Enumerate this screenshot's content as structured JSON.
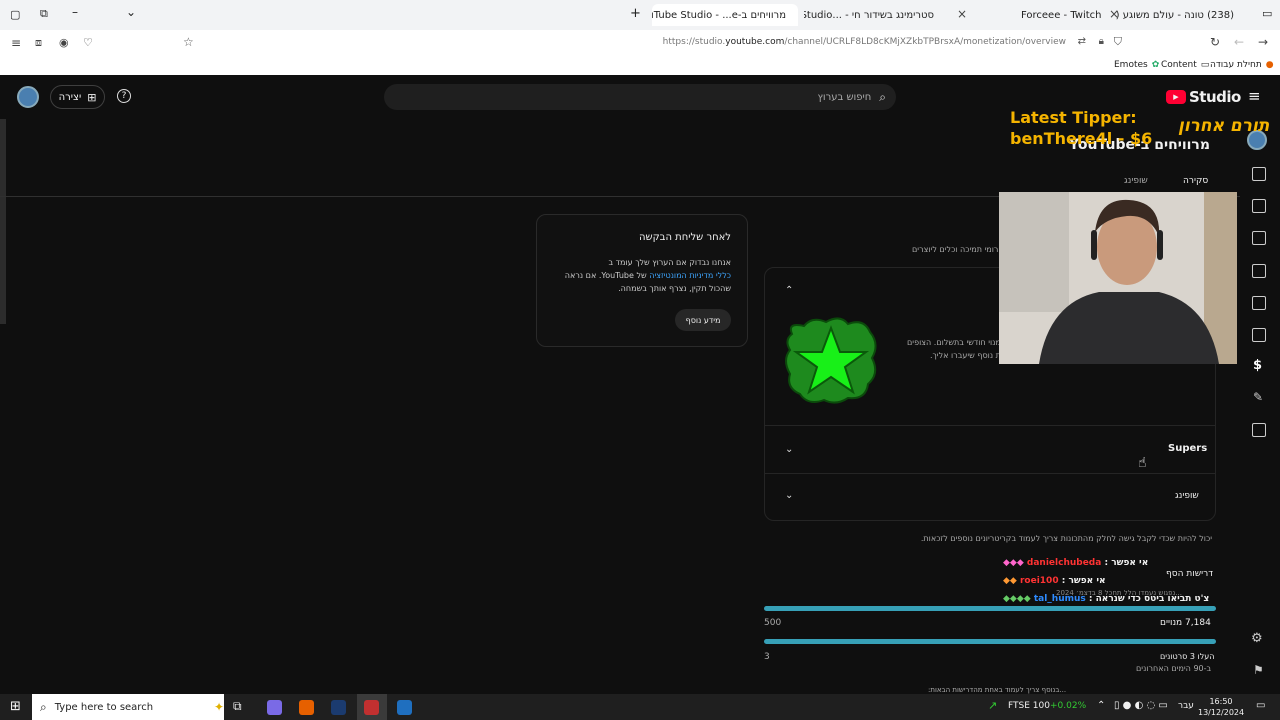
{
  "browser": {
    "tabs": [
      {
        "title": "מרוויחים ב-YouTube Studio - ...e",
        "type": "yt",
        "active": true
      },
      {
        "title": "סטרימינג בשידור חי - ...be Studio",
        "type": "yt",
        "active": false
      },
      {
        "title": "Forceee - Twitch",
        "type": "tw",
        "active": false
      },
      {
        "title": "(238) טונה - עולם משוגע (עם רב",
        "type": "yt",
        "active": false
      }
    ],
    "url_prefix": "https://studio.",
    "url_domain": "youtube.com",
    "url_rest": "/channel/UCRLF8LD8cKMjXZkbTPBrsxA/monetization/overview",
    "bookmarks": [
      {
        "label": "Emotes"
      },
      {
        "label": "Content"
      },
      {
        "label": "תחילת עבודה"
      }
    ]
  },
  "studio": {
    "logo_text": "Studio",
    "search_placeholder": "חיפוש בערוץ",
    "create_label": "יצירה",
    "page_title": "מרוויחים ב-YouTube",
    "tabs": [
      {
        "label": "סקירה",
        "active": true
      },
      {
        "label": "שופינג",
        "active": false
      }
    ],
    "intro_fragment": "...רומי תמיכה וכלים ליוצרים",
    "card": {
      "title": "לאחר שליחת הבקשה",
      "text_1": "אנחנו נבדוק אם הערוץ שלך עומד ב",
      "link": "כללי מדיניות המונטיזציה",
      "text_2": "של YouTube. אם נראה שהכול תקין, נצרף אותך בשמחה.",
      "button": "מידע נוסף"
    },
    "panel": {
      "memberships_text_1": "...מנוי חודשי בתשלום. הצופים",
      "memberships_text_2": "...ת נוסף שיעברו אליך.",
      "supers_label": "Supers",
      "shopping_label": "שופינג"
    },
    "eligibility_note": "יכול להיות שכדי לקבל גישה לחלק מהתכונות צריך לעמוד בקריטריונים נוספים לזכאות.",
    "requirements_label": "דרישות הסף",
    "requirements_sub": "...נפגוש נעמדו הלל תחכל 8 בדצמ׳ 2024",
    "subscribers_label": "7,184 מנויים",
    "subscribers_target": "500",
    "uploads_label": "העלו 3 סרטונים",
    "uploads_sub": "ב-90 הימים האחרונים",
    "uploads_target": "3",
    "bottom_fragment": "...בנוסף צריך לעמוד באחת מהדרישות הבאות:"
  },
  "overlay": {
    "tipper_label": "Latest Tipper:",
    "tipper_value": "benThere4l - $6",
    "tipper_hebrew": "תורם אחרון",
    "chat": [
      {
        "prefix": "אי אפשר :",
        "user": "danielchubeda",
        "user_color": "#ff3333"
      },
      {
        "prefix": "אי אפשר :",
        "user": "roei100",
        "user_color": "#ff3333"
      },
      {
        "prefix": "צ'ט תביאו ביטס כדי שנראה :",
        "user": "tal_humus",
        "user_color": "#2e8bff"
      }
    ]
  },
  "taskbar": {
    "search_placeholder": "Type here to search",
    "ticker_label": "FTSE 100",
    "ticker_change": "+0.02%",
    "lang": "עבר",
    "time": "16:50",
    "date": "13/12/2024"
  },
  "colors": {
    "accent_red": "#ff0033",
    "progress": "#37a0b7",
    "tipper_gold": "#f5b400",
    "link_blue": "#3ea6ff"
  }
}
